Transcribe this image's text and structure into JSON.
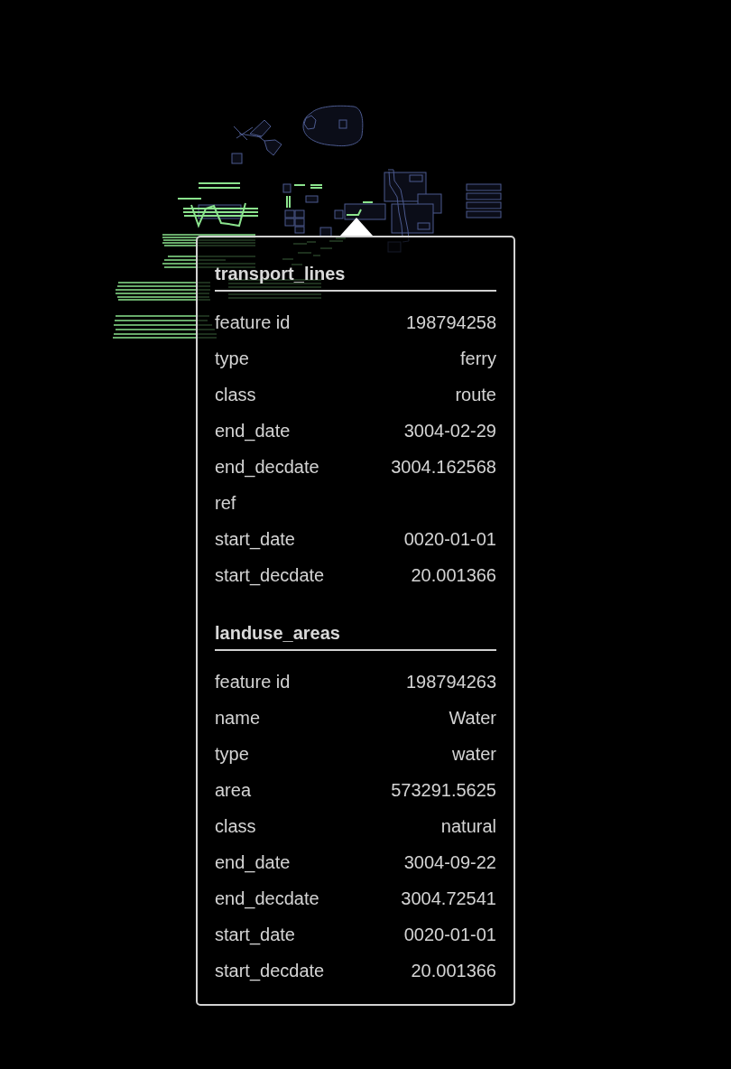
{
  "popup": {
    "sections": [
      {
        "title": "transport_lines",
        "rows": [
          {
            "key": "feature id",
            "value": "198794258"
          },
          {
            "key": "type",
            "value": "ferry"
          },
          {
            "key": "class",
            "value": "route"
          },
          {
            "key": "end_date",
            "value": "3004-02-29"
          },
          {
            "key": "end_decdate",
            "value": "3004.162568"
          },
          {
            "key": "ref"
          },
          {
            "key": "start_date",
            "value": "0020-01-01"
          },
          {
            "key": "start_decdate",
            "value": "20.001366"
          }
        ]
      },
      {
        "title": "landuse_areas",
        "rows": [
          {
            "key": "feature id",
            "value": "198794263"
          },
          {
            "key": "name",
            "value": "Water"
          },
          {
            "key": "type",
            "value": "water"
          },
          {
            "key": "area",
            "value": "573291.5625"
          },
          {
            "key": "class",
            "value": "natural"
          },
          {
            "key": "end_date",
            "value": "3004-09-22"
          },
          {
            "key": "end_decdate",
            "value": "3004.72541"
          },
          {
            "key": "start_date",
            "value": "0020-01-01"
          },
          {
            "key": "start_decdate",
            "value": "20.001366"
          }
        ]
      }
    ]
  }
}
